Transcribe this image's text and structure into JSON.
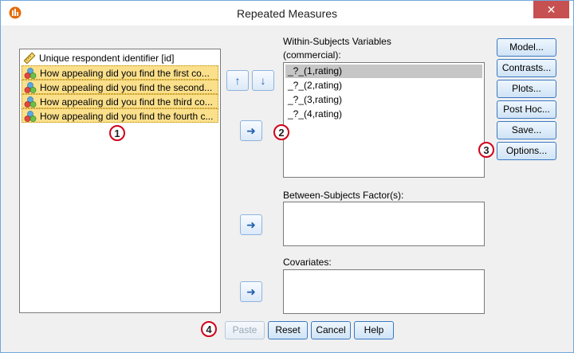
{
  "window": {
    "title": "Repeated Measures",
    "close_glyph": "✕"
  },
  "variables": [
    {
      "label": "Unique respondent identifier [id]",
      "icon": "ruler-icon",
      "selected": false
    },
    {
      "label": "How appealing did you find the first co...",
      "icon": "ordinal-icon",
      "selected": true
    },
    {
      "label": "How appealing did you find the second...",
      "icon": "ordinal-icon",
      "selected": true
    },
    {
      "label": "How appealing did you find the third co...",
      "icon": "ordinal-icon",
      "selected": true
    },
    {
      "label": "How appealing did you find the fourth c...",
      "icon": "ordinal-icon",
      "selected": true
    }
  ],
  "within": {
    "label_line1": "Within-Subjects Variables",
    "label_line2": "(commercial):",
    "items": [
      "_?_(1,rating)",
      "_?_(2,rating)",
      "_?_(3,rating)",
      "_?_(4,rating)"
    ],
    "selected_index": 0
  },
  "between": {
    "label": "Between-Subjects Factor(s):"
  },
  "covariates": {
    "label": "Covariates:"
  },
  "side_buttons": [
    "Model...",
    "Contrasts...",
    "Plots...",
    "Post Hoc...",
    "Save...",
    "Options..."
  ],
  "bottom_buttons": {
    "paste": "Paste",
    "reset": "Reset",
    "cancel": "Cancel",
    "help": "Help"
  },
  "annotations": [
    "1",
    "2",
    "3",
    "4"
  ],
  "colors": {
    "accent": "#3a78c2",
    "badge": "#d0021b",
    "selection": "#fbe08c",
    "close": "#c75050"
  }
}
